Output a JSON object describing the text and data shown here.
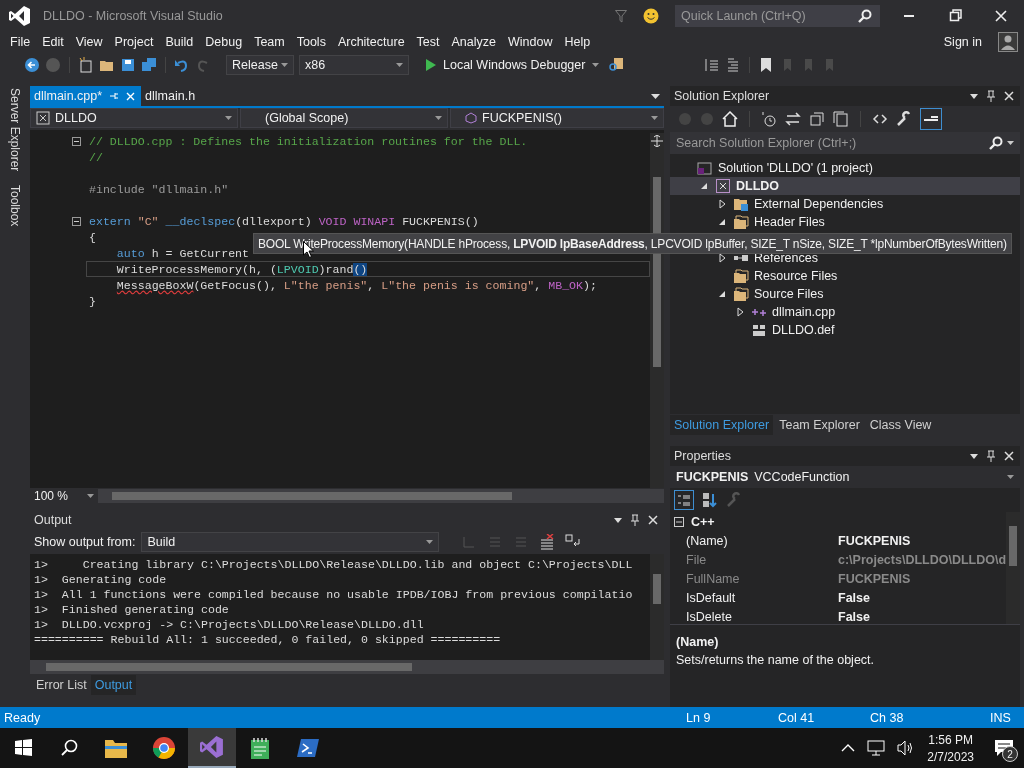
{
  "window": {
    "title": "DLLDO - Microsoft Visual Studio"
  },
  "quick_launch": {
    "placeholder": "Quick Launch (Ctrl+Q)"
  },
  "menu": [
    "File",
    "Edit",
    "View",
    "Project",
    "Build",
    "Debug",
    "Team",
    "Tools",
    "Architecture",
    "Test",
    "Analyze",
    "Window",
    "Help"
  ],
  "account": {
    "label": "Sign in"
  },
  "toolbar": {
    "configuration": "Release",
    "platform": "x86",
    "debugger": "Local Windows Debugger"
  },
  "side_tabs": [
    "Server Explorer",
    "Toolbox"
  ],
  "editor": {
    "tabs": [
      {
        "label": "dllmain.cpp*",
        "selected": true
      },
      {
        "label": "dllmain.h",
        "selected": false
      }
    ],
    "nav": [
      "DLLDO",
      "(Global Scope)",
      "FUCKPENIS()"
    ],
    "lines": [
      {
        "fold": true,
        "current": false,
        "tokens": [
          {
            "kind": "comment",
            "text": "// DLLDO.cpp : Defines the initialization routines for the DLL."
          }
        ]
      },
      {
        "fold": false,
        "current": false,
        "tokens": [
          {
            "kind": "comment",
            "text": "//"
          }
        ]
      },
      {
        "fold": false,
        "current": false
      },
      {
        "fold": false,
        "current": false,
        "tokens": [
          {
            "kind": "pre",
            "text": "#include \"dllmain.h\""
          }
        ]
      },
      {
        "fold": false,
        "current": false
      },
      {
        "fold": true,
        "current": false,
        "tokens": [
          {
            "kind": "keyword",
            "text": "extern"
          },
          {
            "kind": "string",
            "text": " \"C\""
          },
          {
            "kind": "keyword",
            "text": " __declspec"
          },
          {
            "kind": "plain",
            "text": "(dllexport) "
          },
          {
            "kind": "macro",
            "text": "VOID"
          },
          {
            "kind": "macro",
            "text": " WINAPI"
          },
          {
            "kind": "plain",
            "text": " FUCKPENIS()"
          }
        ]
      },
      {
        "fold": false,
        "current": false,
        "tokens": [
          {
            "kind": "plain",
            "text": "{"
          }
        ]
      },
      {
        "fold": false,
        "current": false,
        "tokens": [
          {
            "kind": "keyword",
            "text": "    auto"
          },
          {
            "kind": "plain",
            "text": " h = GetCurrent"
          }
        ]
      },
      {
        "fold": false,
        "current": true,
        "tokens": [
          {
            "kind": "plain",
            "text": "    WriteProcessMemory(h, ("
          },
          {
            "kind": "type",
            "text": "LPVOID"
          },
          {
            "kind": "plain",
            "text": ")rand"
          },
          {
            "kind": "match",
            "text": "()"
          }
        ]
      },
      {
        "fold": false,
        "current": false,
        "tokens": [
          {
            "kind": "error",
            "text": "    MessageBoxW"
          },
          {
            "kind": "plain",
            "text": "(GetFocus(), "
          },
          {
            "kind": "string",
            "text": "L\"the penis\""
          },
          {
            "kind": "plain",
            "text": ", "
          },
          {
            "kind": "string",
            "text": "L\"the penis is coming\""
          },
          {
            "kind": "plain",
            "text": ", "
          },
          {
            "kind": "macro",
            "text": "MB_OK"
          },
          {
            "kind": "plain",
            "text": ");"
          }
        ]
      },
      {
        "fold": false,
        "current": false,
        "tokens": [
          {
            "kind": "plain",
            "text": "}"
          }
        ]
      }
    ],
    "zoom": "100 %",
    "tooltip": "BOOL WriteProcessMemory(HANDLE hProcess, **LPVOID lpBaseAddress**, LPCVOID lpBuffer, SIZE_T nSize, SIZE_T *lpNumberOfBytesWritten)"
  },
  "output": {
    "title": "Output",
    "source_label": "Show output from:",
    "source": "Build",
    "lines": [
      "1>     Creating library C:\\Projects\\DLLDO\\Release\\DLLDO.lib and object C:\\Projects\\DLL",
      "1>  Generating code",
      "1>  All 1 functions were compiled because no usable IPDB/IOBJ from previous compilatio",
      "1>  Finished generating code",
      "1>  DLLDO.vcxproj -> C:\\Projects\\DLLDO\\Release\\DLLDO.dll",
      "========== Rebuild All: 1 succeeded, 0 failed, 0 skipped =========="
    ],
    "tabs": [
      {
        "label": "Error List",
        "selected": false
      },
      {
        "label": "Output",
        "selected": true
      }
    ]
  },
  "solution_explorer": {
    "title": "Solution Explorer",
    "search": {
      "placeholder": "Search Solution Explorer (Ctrl+;)"
    },
    "tree": [
      {
        "label": "Solution 'DLLDO' (1 project)",
        "kind": "solution",
        "selected": false,
        "children": [
          {
            "label": "DLLDO",
            "kind": "project",
            "selected": true,
            "expanded": true,
            "children": [
              {
                "label": "External Dependencies",
                "kind": "deps",
                "selected": false,
                "expanded": false
              },
              {
                "label": "Header Files",
                "kind": "filter",
                "selected": false,
                "expanded": true
              },
              {
                "label": "References",
                "kind": "references",
                "selected": false,
                "expanded": false
              },
              {
                "label": "Resource Files",
                "kind": "filter",
                "selected": false
              },
              {
                "label": "Source Files",
                "kind": "filter",
                "selected": false,
                "expanded": true,
                "children": [
                  {
                    "label": "dllmain.cpp",
                    "kind": "cpp",
                    "selected": false,
                    "expanded": false
                  },
                  {
                    "label": "DLLDO.def",
                    "kind": "def",
                    "selected": false
                  }
                ]
              }
            ]
          }
        ]
      }
    ],
    "tabs": [
      {
        "label": "Solution Explorer",
        "selected": true
      },
      {
        "label": "Team Explorer",
        "selected": false
      },
      {
        "label": "Class View",
        "selected": false
      }
    ]
  },
  "properties": {
    "title": "Properties",
    "object_name": "FUCKPENIS",
    "object_type": "VCCodeFunction",
    "category": "C++",
    "rows": [
      {
        "name": "(Name)",
        "value": "FUCKPENIS",
        "disabled": false
      },
      {
        "name": "File",
        "value": "c:\\Projects\\DLLDO\\DLLDO\\d",
        "disabled": true
      },
      {
        "name": "FullName",
        "value": "FUCKPENIS",
        "disabled": true
      },
      {
        "name": "IsDefault",
        "value": "False",
        "disabled": false
      },
      {
        "name": "IsDelete",
        "value": "False",
        "disabled": false
      }
    ],
    "description_title": "(Name)",
    "description": "Sets/returns the name of the object."
  },
  "status_bar": {
    "state": "Ready",
    "line": "Ln 9",
    "column": "Col 41",
    "char": "Ch 38",
    "mode": "INS"
  },
  "taskbar": {
    "apps": [
      {
        "kind": "folder",
        "selected": false
      },
      {
        "kind": "browser",
        "selected": false
      },
      {
        "kind": "studio",
        "selected": true
      },
      {
        "kind": "notes",
        "selected": false
      },
      {
        "kind": "shell",
        "selected": false
      }
    ],
    "time": "1:56 PM",
    "date": "2/7/2023",
    "notifications": "2"
  }
}
